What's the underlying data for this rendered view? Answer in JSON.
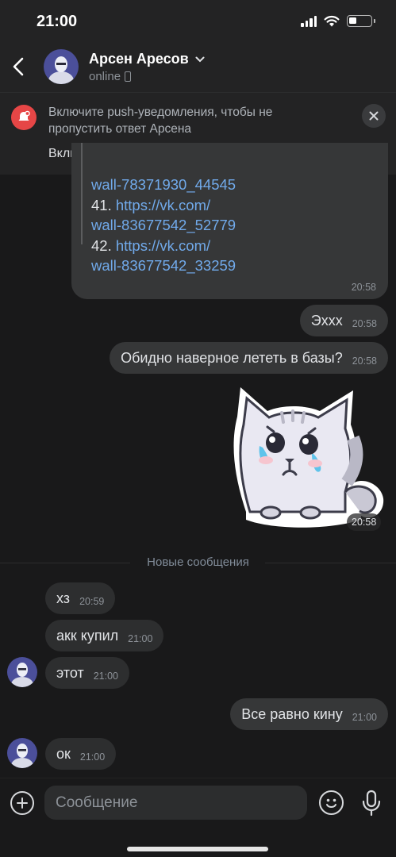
{
  "status_bar": {
    "time": "21:00",
    "battery_level": 0.3
  },
  "header": {
    "name": "Арсен Аресов",
    "status": "online",
    "icons": [
      "back-chevron-icon",
      "chevron-down-icon",
      "phone-device-icon"
    ]
  },
  "push_banner": {
    "text": "Включите push-уведомления, чтобы не пропустить ответ Арсена",
    "action": "Включить уведомления"
  },
  "messages": {
    "long_message": {
      "lines": [
        {
          "prefix": "",
          "link": "wall-78371930_44545"
        },
        {
          "prefix": "41. ",
          "link": "https://vk.com/"
        },
        {
          "prefix": "",
          "link": "wall-83677542_52779"
        },
        {
          "prefix": "42. ",
          "link": "https://vk.com/"
        },
        {
          "prefix": "",
          "link": "wall-83677542_33259"
        }
      ],
      "time": "20:58"
    },
    "out_1": {
      "text": "Эххх",
      "time": "20:58"
    },
    "out_2": {
      "text": "Обидно наверное лететь в базы?",
      "time": "20:58"
    },
    "sticker": {
      "time": "20:58",
      "description_icon": "crying-cat-sticker"
    },
    "divider": "Новые сообщения",
    "in_1": {
      "text": "хз",
      "time": "20:59"
    },
    "in_2": {
      "text": "акк купил",
      "time": "21:00"
    },
    "in_3": {
      "text": "этот",
      "time": "21:00"
    },
    "out_3": {
      "text": "Все равно кину",
      "time": "21:00"
    },
    "in_4": {
      "text": "ок",
      "time": "21:00"
    }
  },
  "composer": {
    "placeholder": "Сообщение"
  },
  "colors": {
    "link": "#71aaeb",
    "accent_red": "#e64646",
    "background": "#19191a"
  }
}
